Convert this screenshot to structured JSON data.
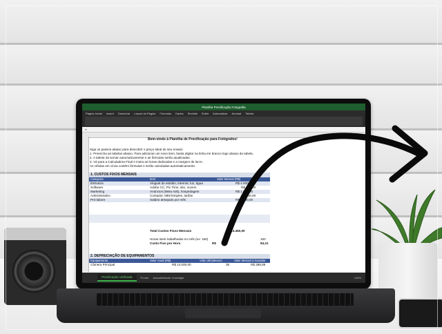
{
  "excel": {
    "window_title": "Planilha Precificação Fotografia",
    "ribbon_tabs": [
      "Página Inicial",
      "Inserir",
      "Desenhar",
      "Layout da Página",
      "Fórmulas",
      "Dados",
      "Revisão",
      "Exibir",
      "Automatizar",
      "Acrobat",
      "Tabela"
    ],
    "sheet_title": "Bem-vindo à Planilha de Precificação para Fotógrafos!",
    "intro": [
      "Siga os passos abaixo para descobrir o preço ideal do seu ensaio:",
      "1. Preencha as tabelas abaixo. Para adicionar um novo item, basta digitar na linha em branco logo abaixo da tabela.",
      "2. A tabela irá somar automaticamente e as fórmulas serão atualizadas.",
      "3. Vá para a Calculadora Final e insira as horas dedicadas e a margem de lucro.",
      "As células em cinza contêm fórmulas e serão calculadas automaticamente."
    ],
    "section1": {
      "title": "1. CUSTOS FIXOS MENSAIS",
      "headers": [
        "Categoria",
        "Item",
        "Valor Mensal (R$)"
      ],
      "rows": [
        [
          "Estrutura",
          "Aluguel do estúdio, internet, luz, água",
          "R$ 4.000,00"
        ],
        [
          "Software",
          "Adobe CC, Pic Time, site, nuvem",
          "R$ 150,00"
        ],
        [
          "Marketing",
          "Anúncios (Meta Ads), hospedagem",
          "R$ 1.000,00"
        ],
        [
          "Administrativo",
          "Contador, MEI/Simples, tarifas",
          "R$ 300,00"
        ],
        [
          "Pró-labore",
          "Salário desejado por mês",
          "R$ 8.000,00"
        ]
      ],
      "total_label": "Total Custos Fixos Mensais",
      "total_value": "R$ 13.450,00",
      "hours_label": "Horas úteis trabalhadas no mês (ex: 160)",
      "hours_value": "160",
      "cost_hour_label": "Custo Fixo por Hora",
      "cost_hour_currency": "R$",
      "cost_hour_value": "84,31"
    },
    "section2": {
      "title": "2. DEPRECIAÇÃO DE EQUIPAMENTOS",
      "headers": [
        "Equipamento",
        "Valor Atual (R$)",
        "Vida Útil (Meses)",
        "Valor Mensal a Guardar (R$)"
      ],
      "rows": [
        [
          "Câmera Principal",
          "R$ 14.000,00",
          "36",
          "R$ 388,89"
        ]
      ]
    },
    "sheet_tab": "Precificação Unificada",
    "status": [
      "Pronto",
      "Acessibilidade: Investigar"
    ],
    "zoom": "140%"
  },
  "colors": {
    "accent": "#3bb54a",
    "table_header": "#3b5998",
    "section_bg": "#d8dee9"
  }
}
